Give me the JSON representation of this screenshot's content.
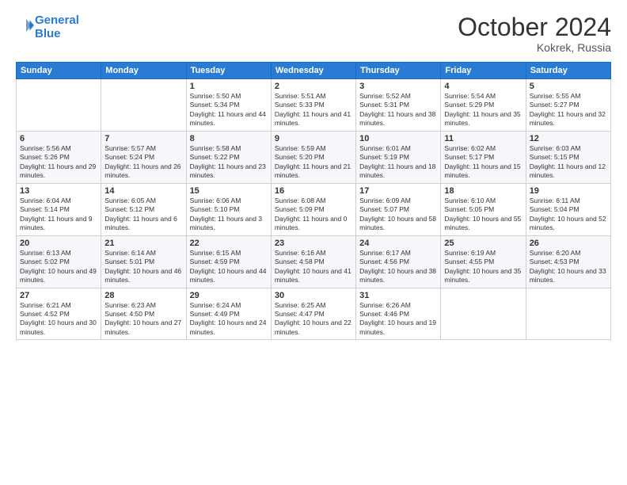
{
  "logo": {
    "line1": "General",
    "line2": "Blue"
  },
  "title": "October 2024",
  "location": "Kokrek, Russia",
  "header": {
    "days": [
      "Sunday",
      "Monday",
      "Tuesday",
      "Wednesday",
      "Thursday",
      "Friday",
      "Saturday"
    ]
  },
  "weeks": [
    [
      {
        "day": null,
        "info": null
      },
      {
        "day": null,
        "info": null
      },
      {
        "day": "1",
        "info": "Sunrise: 5:50 AM\nSunset: 5:34 PM\nDaylight: 11 hours and 44 minutes."
      },
      {
        "day": "2",
        "info": "Sunrise: 5:51 AM\nSunset: 5:33 PM\nDaylight: 11 hours and 41 minutes."
      },
      {
        "day": "3",
        "info": "Sunrise: 5:52 AM\nSunset: 5:31 PM\nDaylight: 11 hours and 38 minutes."
      },
      {
        "day": "4",
        "info": "Sunrise: 5:54 AM\nSunset: 5:29 PM\nDaylight: 11 hours and 35 minutes."
      },
      {
        "day": "5",
        "info": "Sunrise: 5:55 AM\nSunset: 5:27 PM\nDaylight: 11 hours and 32 minutes."
      }
    ],
    [
      {
        "day": "6",
        "info": "Sunrise: 5:56 AM\nSunset: 5:26 PM\nDaylight: 11 hours and 29 minutes."
      },
      {
        "day": "7",
        "info": "Sunrise: 5:57 AM\nSunset: 5:24 PM\nDaylight: 11 hours and 26 minutes."
      },
      {
        "day": "8",
        "info": "Sunrise: 5:58 AM\nSunset: 5:22 PM\nDaylight: 11 hours and 23 minutes."
      },
      {
        "day": "9",
        "info": "Sunrise: 5:59 AM\nSunset: 5:20 PM\nDaylight: 11 hours and 21 minutes."
      },
      {
        "day": "10",
        "info": "Sunrise: 6:01 AM\nSunset: 5:19 PM\nDaylight: 11 hours and 18 minutes."
      },
      {
        "day": "11",
        "info": "Sunrise: 6:02 AM\nSunset: 5:17 PM\nDaylight: 11 hours and 15 minutes."
      },
      {
        "day": "12",
        "info": "Sunrise: 6:03 AM\nSunset: 5:15 PM\nDaylight: 11 hours and 12 minutes."
      }
    ],
    [
      {
        "day": "13",
        "info": "Sunrise: 6:04 AM\nSunset: 5:14 PM\nDaylight: 11 hours and 9 minutes."
      },
      {
        "day": "14",
        "info": "Sunrise: 6:05 AM\nSunset: 5:12 PM\nDaylight: 11 hours and 6 minutes."
      },
      {
        "day": "15",
        "info": "Sunrise: 6:06 AM\nSunset: 5:10 PM\nDaylight: 11 hours and 3 minutes."
      },
      {
        "day": "16",
        "info": "Sunrise: 6:08 AM\nSunset: 5:09 PM\nDaylight: 11 hours and 0 minutes."
      },
      {
        "day": "17",
        "info": "Sunrise: 6:09 AM\nSunset: 5:07 PM\nDaylight: 10 hours and 58 minutes."
      },
      {
        "day": "18",
        "info": "Sunrise: 6:10 AM\nSunset: 5:05 PM\nDaylight: 10 hours and 55 minutes."
      },
      {
        "day": "19",
        "info": "Sunrise: 6:11 AM\nSunset: 5:04 PM\nDaylight: 10 hours and 52 minutes."
      }
    ],
    [
      {
        "day": "20",
        "info": "Sunrise: 6:13 AM\nSunset: 5:02 PM\nDaylight: 10 hours and 49 minutes."
      },
      {
        "day": "21",
        "info": "Sunrise: 6:14 AM\nSunset: 5:01 PM\nDaylight: 10 hours and 46 minutes."
      },
      {
        "day": "22",
        "info": "Sunrise: 6:15 AM\nSunset: 4:59 PM\nDaylight: 10 hours and 44 minutes."
      },
      {
        "day": "23",
        "info": "Sunrise: 6:16 AM\nSunset: 4:58 PM\nDaylight: 10 hours and 41 minutes."
      },
      {
        "day": "24",
        "info": "Sunrise: 6:17 AM\nSunset: 4:56 PM\nDaylight: 10 hours and 38 minutes."
      },
      {
        "day": "25",
        "info": "Sunrise: 6:19 AM\nSunset: 4:55 PM\nDaylight: 10 hours and 35 minutes."
      },
      {
        "day": "26",
        "info": "Sunrise: 6:20 AM\nSunset: 4:53 PM\nDaylight: 10 hours and 33 minutes."
      }
    ],
    [
      {
        "day": "27",
        "info": "Sunrise: 6:21 AM\nSunset: 4:52 PM\nDaylight: 10 hours and 30 minutes."
      },
      {
        "day": "28",
        "info": "Sunrise: 6:23 AM\nSunset: 4:50 PM\nDaylight: 10 hours and 27 minutes."
      },
      {
        "day": "29",
        "info": "Sunrise: 6:24 AM\nSunset: 4:49 PM\nDaylight: 10 hours and 24 minutes."
      },
      {
        "day": "30",
        "info": "Sunrise: 6:25 AM\nSunset: 4:47 PM\nDaylight: 10 hours and 22 minutes."
      },
      {
        "day": "31",
        "info": "Sunrise: 6:26 AM\nSunset: 4:46 PM\nDaylight: 10 hours and 19 minutes."
      },
      {
        "day": null,
        "info": null
      },
      {
        "day": null,
        "info": null
      }
    ]
  ]
}
